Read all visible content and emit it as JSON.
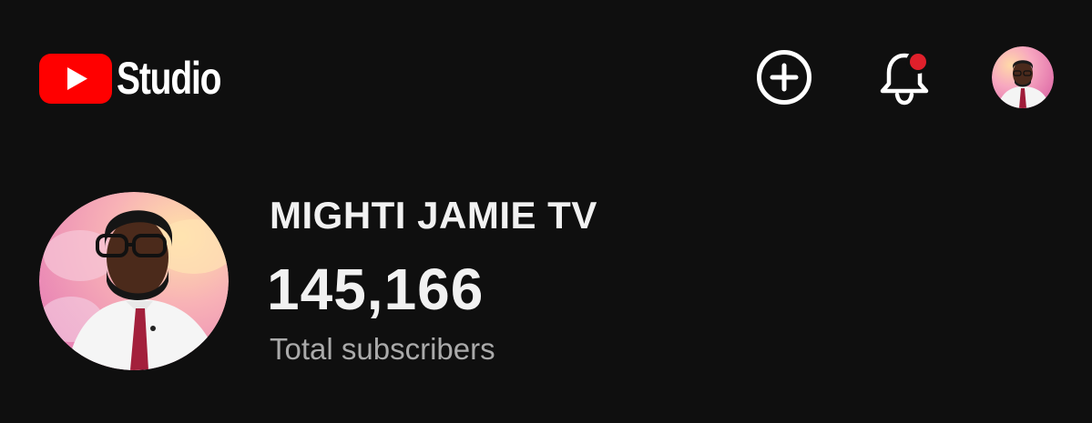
{
  "header": {
    "logo_text": "Studio",
    "brand_color": "#ff0000",
    "icons": {
      "create": "add-circle-icon",
      "notifications": "bell-icon",
      "notification_dot_color": "#e0202b",
      "account": "account-avatar"
    }
  },
  "channel": {
    "name": "MIGHTI JAMIE TV",
    "subscriber_count": "145,166",
    "subscriber_label": "Total subscribers"
  }
}
